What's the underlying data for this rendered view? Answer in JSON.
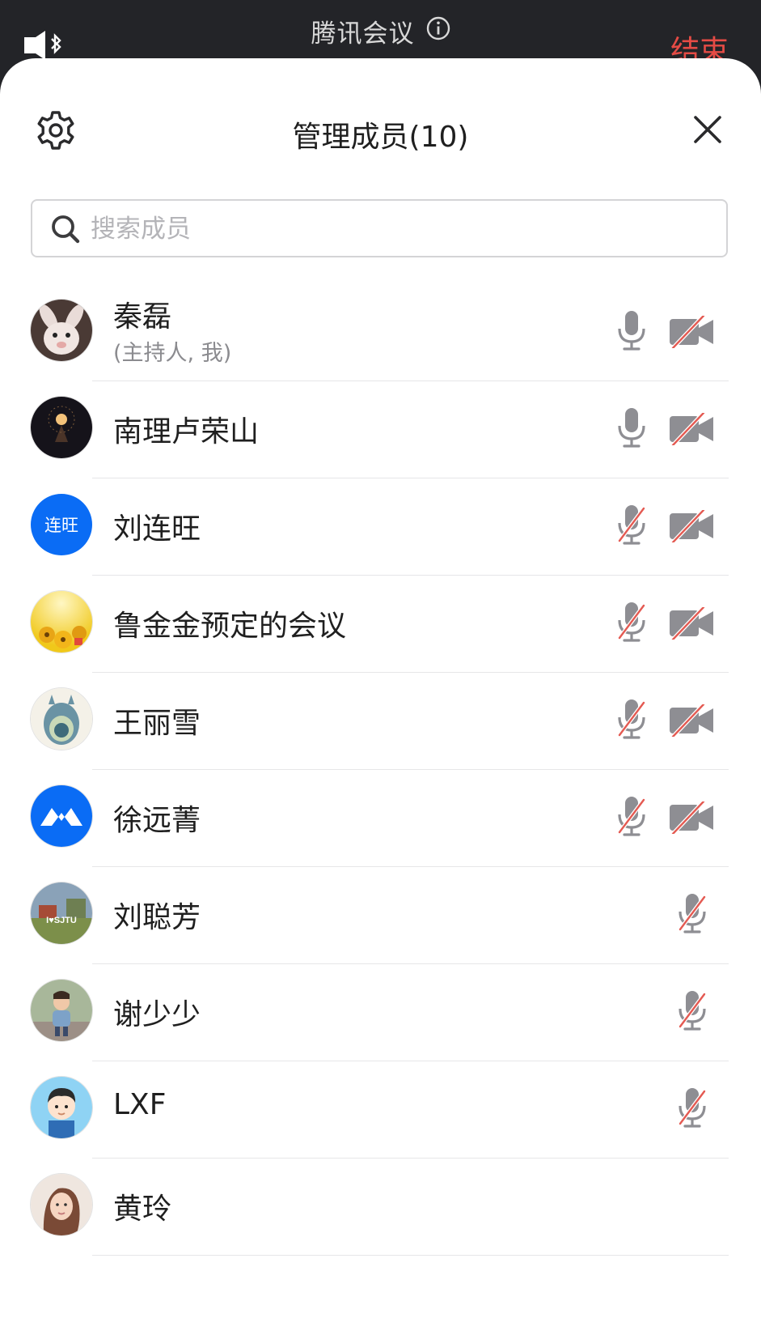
{
  "topbar": {
    "title": "腾讯会议",
    "end_label": "结束"
  },
  "panel": {
    "title": "管理成员(10)"
  },
  "search": {
    "placeholder": "搜索成员"
  },
  "colors": {
    "end_red": "#e54b45",
    "muted_red": "#e45a52",
    "icon_gray": "#8e8e93",
    "avatar_blue": "#0a6cf5"
  },
  "members": [
    {
      "name": "秦磊",
      "role": "(主持人, 我)",
      "avatar": "rabbit-photo",
      "mic": "on",
      "camera": "off"
    },
    {
      "name": "南理卢荣山",
      "avatar": "dark-photo",
      "mic": "on",
      "camera": "off"
    },
    {
      "name": "刘连旺",
      "avatar_text": "连旺",
      "avatar": "text-avatar",
      "mic": "off",
      "camera": "off"
    },
    {
      "name": "鲁金金预定的会议",
      "avatar": "flowers-photo",
      "mic": "off",
      "camera": "off"
    },
    {
      "name": "王丽雪",
      "avatar": "totoro-photo",
      "mic": "off",
      "camera": "off"
    },
    {
      "name": "徐远菁",
      "avatar": "meeting-logo",
      "mic": "off",
      "camera": "off"
    },
    {
      "name": "刘聪芳",
      "avatar": "campus-photo",
      "avatar_text": "I♥SJTU",
      "mic": "off"
    },
    {
      "name": "谢少少",
      "avatar": "child-photo",
      "mic": "off"
    },
    {
      "name": "LXF",
      "avatar": "cartoon-boy",
      "mic": "off"
    },
    {
      "name": "黄玲",
      "avatar": "portrait-photo"
    }
  ]
}
